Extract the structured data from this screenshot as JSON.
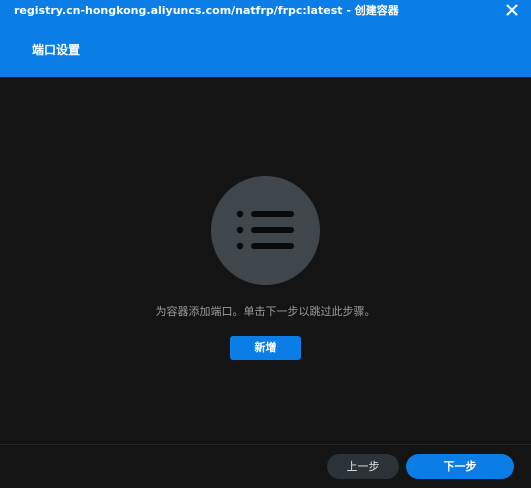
{
  "window": {
    "title": "registry.cn-hongkong.aliyuncs.com/natfrp/frpc:latest - 创建容器",
    "close_icon": "close-icon"
  },
  "header": {
    "section_title": "端口设置"
  },
  "empty_state": {
    "icon": "list-icon",
    "hint": "为容器添加端口。单击下一步以跳过此步骤。",
    "add_label": "新增"
  },
  "footer": {
    "prev_label": "上一步",
    "next_label": "下一步"
  },
  "colors": {
    "accent": "#0a7ee6",
    "background": "#141414",
    "icon_circle": "#3f474d",
    "secondary_button": "#2b3238"
  }
}
